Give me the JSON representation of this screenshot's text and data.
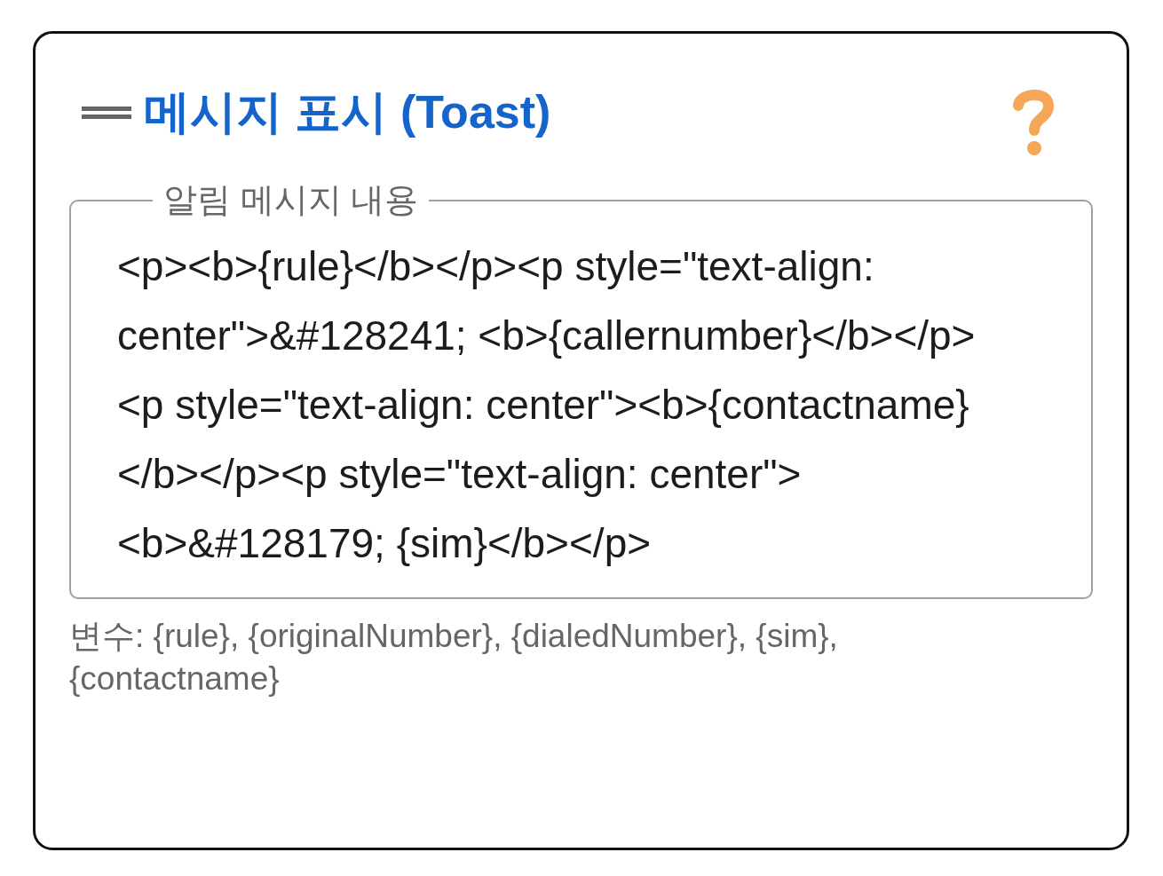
{
  "title": "메시지 표시 (Toast)",
  "message_field": {
    "label": "알림 메시지 내용",
    "value": "<p><b>{rule}</b></p><p style=\"text-align: center\">&#128241; <b>{callernumber}</b></p><p style=\"text-align: center\"><b>{contactname}</b></p><p style=\"text-align: center\"><b>&#128179; {sim}</b></p>"
  },
  "hint": "변수: {rule}, {originalNumber}, {dialedNumber}, {sim}, {contactname}"
}
